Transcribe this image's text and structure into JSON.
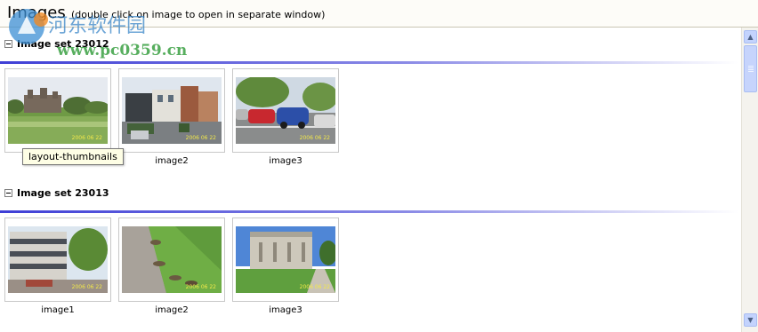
{
  "header": {
    "title": "Images",
    "hint": "(double click on image to open in separate window)"
  },
  "watermark": {
    "site_cn": "河东软件园",
    "site_url": "www.pc0359.cn"
  },
  "image_sets": [
    {
      "title": "Image set 23012",
      "images": [
        {
          "caption": "",
          "stamp": "2006 06 22",
          "scene": "field-manor"
        },
        {
          "caption": "image2",
          "stamp": "2006 06 22",
          "scene": "modern-building"
        },
        {
          "caption": "image3",
          "stamp": "2006 06 22",
          "scene": "parked-cars"
        }
      ]
    },
    {
      "title": "Image set 23013",
      "images": [
        {
          "caption": "image1",
          "stamp": "2006 06 22",
          "scene": "office-block"
        },
        {
          "caption": "image2",
          "stamp": "2006 06 22",
          "scene": "ducks-path"
        },
        {
          "caption": "image3",
          "stamp": "2006 06 22",
          "scene": "classical-building"
        }
      ]
    }
  ],
  "tooltip": "layout-thumbnails",
  "colors": {
    "rule_start": "#3f3fd6",
    "header_bg": "#fdfcf8",
    "scrollbar_accent": "#c3d3fd"
  }
}
